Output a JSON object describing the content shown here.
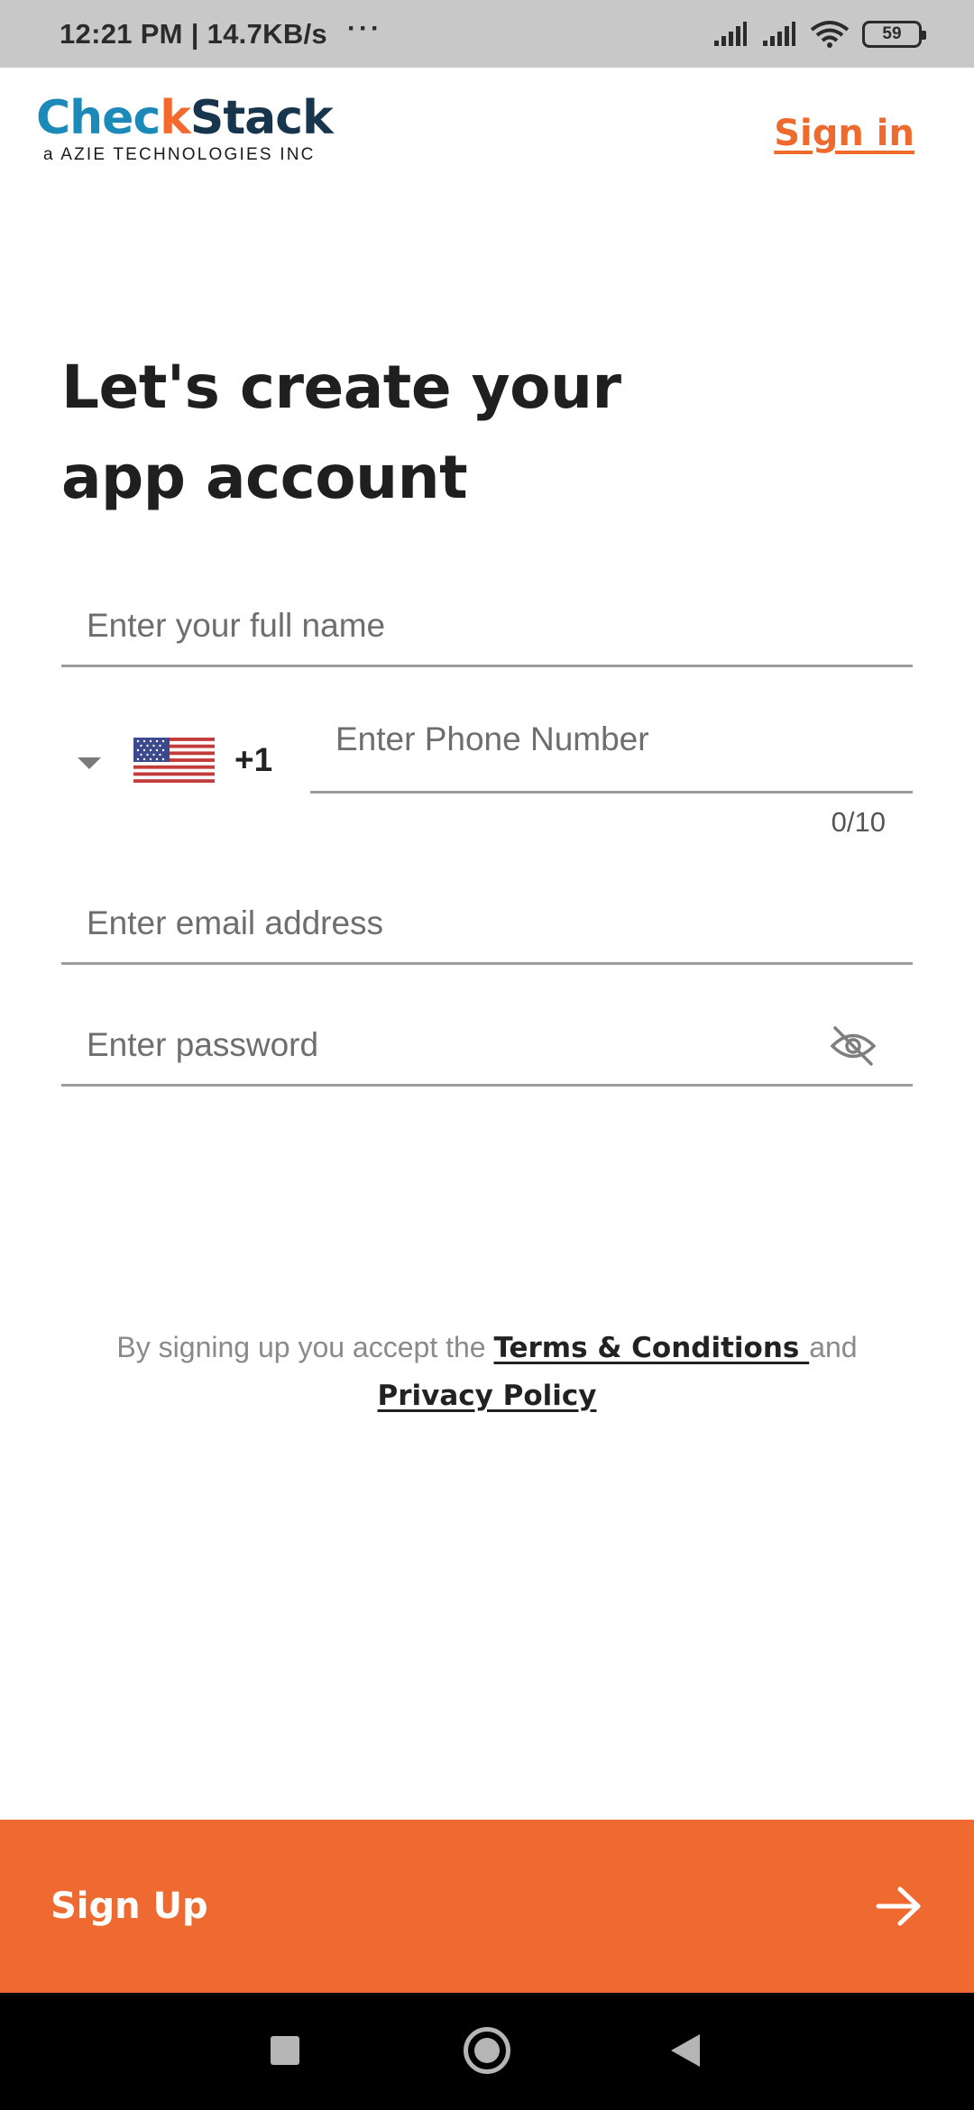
{
  "status_bar": {
    "time": "12:21 PM | 14.7KB/s",
    "dots": "···",
    "battery": "59"
  },
  "header": {
    "logo": {
      "part1": "Chec",
      "part2": "k",
      "part3": "Stack",
      "subtitle": "a AZIE TECHNOLOGIES INC"
    },
    "signin_label": "Sign in"
  },
  "title_line1": "Let's create your",
  "title_line2": "app account",
  "form": {
    "name_placeholder": "Enter your full name",
    "phone": {
      "country_flag": "us-flag",
      "dial_code": "+1",
      "placeholder": "Enter Phone Number",
      "counter": "0/10"
    },
    "email_placeholder": "Enter email address",
    "password_placeholder": "Enter password",
    "password_toggle_icon": "eye-off-icon"
  },
  "legal": {
    "prefix": "By signing up you accept the ",
    "terms_label": "Terms & Conditions ",
    "and": "and",
    "privacy_label": "Privacy Policy"
  },
  "signup": {
    "label": "Sign Up",
    "icon": "arrow-right-icon"
  },
  "colors": {
    "accent": "#ee6a30",
    "logo_blue": "#1b8ab8",
    "logo_navy": "#17354d"
  }
}
